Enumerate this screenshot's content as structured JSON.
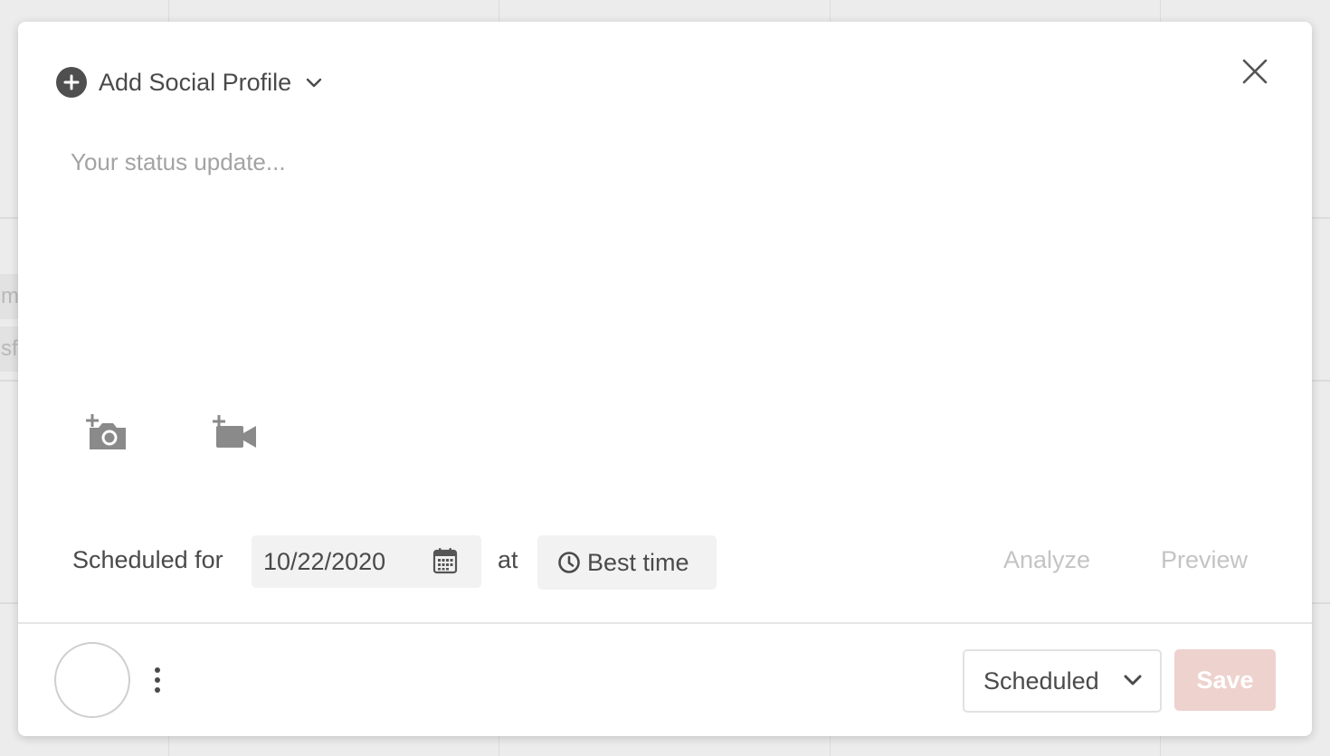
{
  "background": {
    "peek_text_1": "m",
    "peek_text_2": "sf"
  },
  "composer": {
    "profile_selector": {
      "label": "Add Social Profile",
      "icon": "plus-circle-icon"
    },
    "close_icon": "close-icon",
    "status": {
      "value": "",
      "placeholder": "Your status update..."
    },
    "media": [
      {
        "icon": "add-photo-icon"
      },
      {
        "icon": "add-video-icon"
      }
    ]
  },
  "schedule": {
    "label": "Scheduled for",
    "date": "10/22/2020",
    "date_icon": "calendar-icon",
    "at_label": "at",
    "time_label": "Best time",
    "time_icon": "clock-icon",
    "analyze_label": "Analyze",
    "preview_label": "Preview"
  },
  "footer": {
    "more_icon": "vertical-ellipsis-icon",
    "status_select": {
      "value": "Scheduled"
    },
    "save_label": "Save"
  },
  "colors": {
    "primary_text": "#4a4a4a",
    "disabled_link": "#c4c4c4",
    "save_disabled_bg": "#eed2cd",
    "placeholder": "#a3a3a3"
  }
}
